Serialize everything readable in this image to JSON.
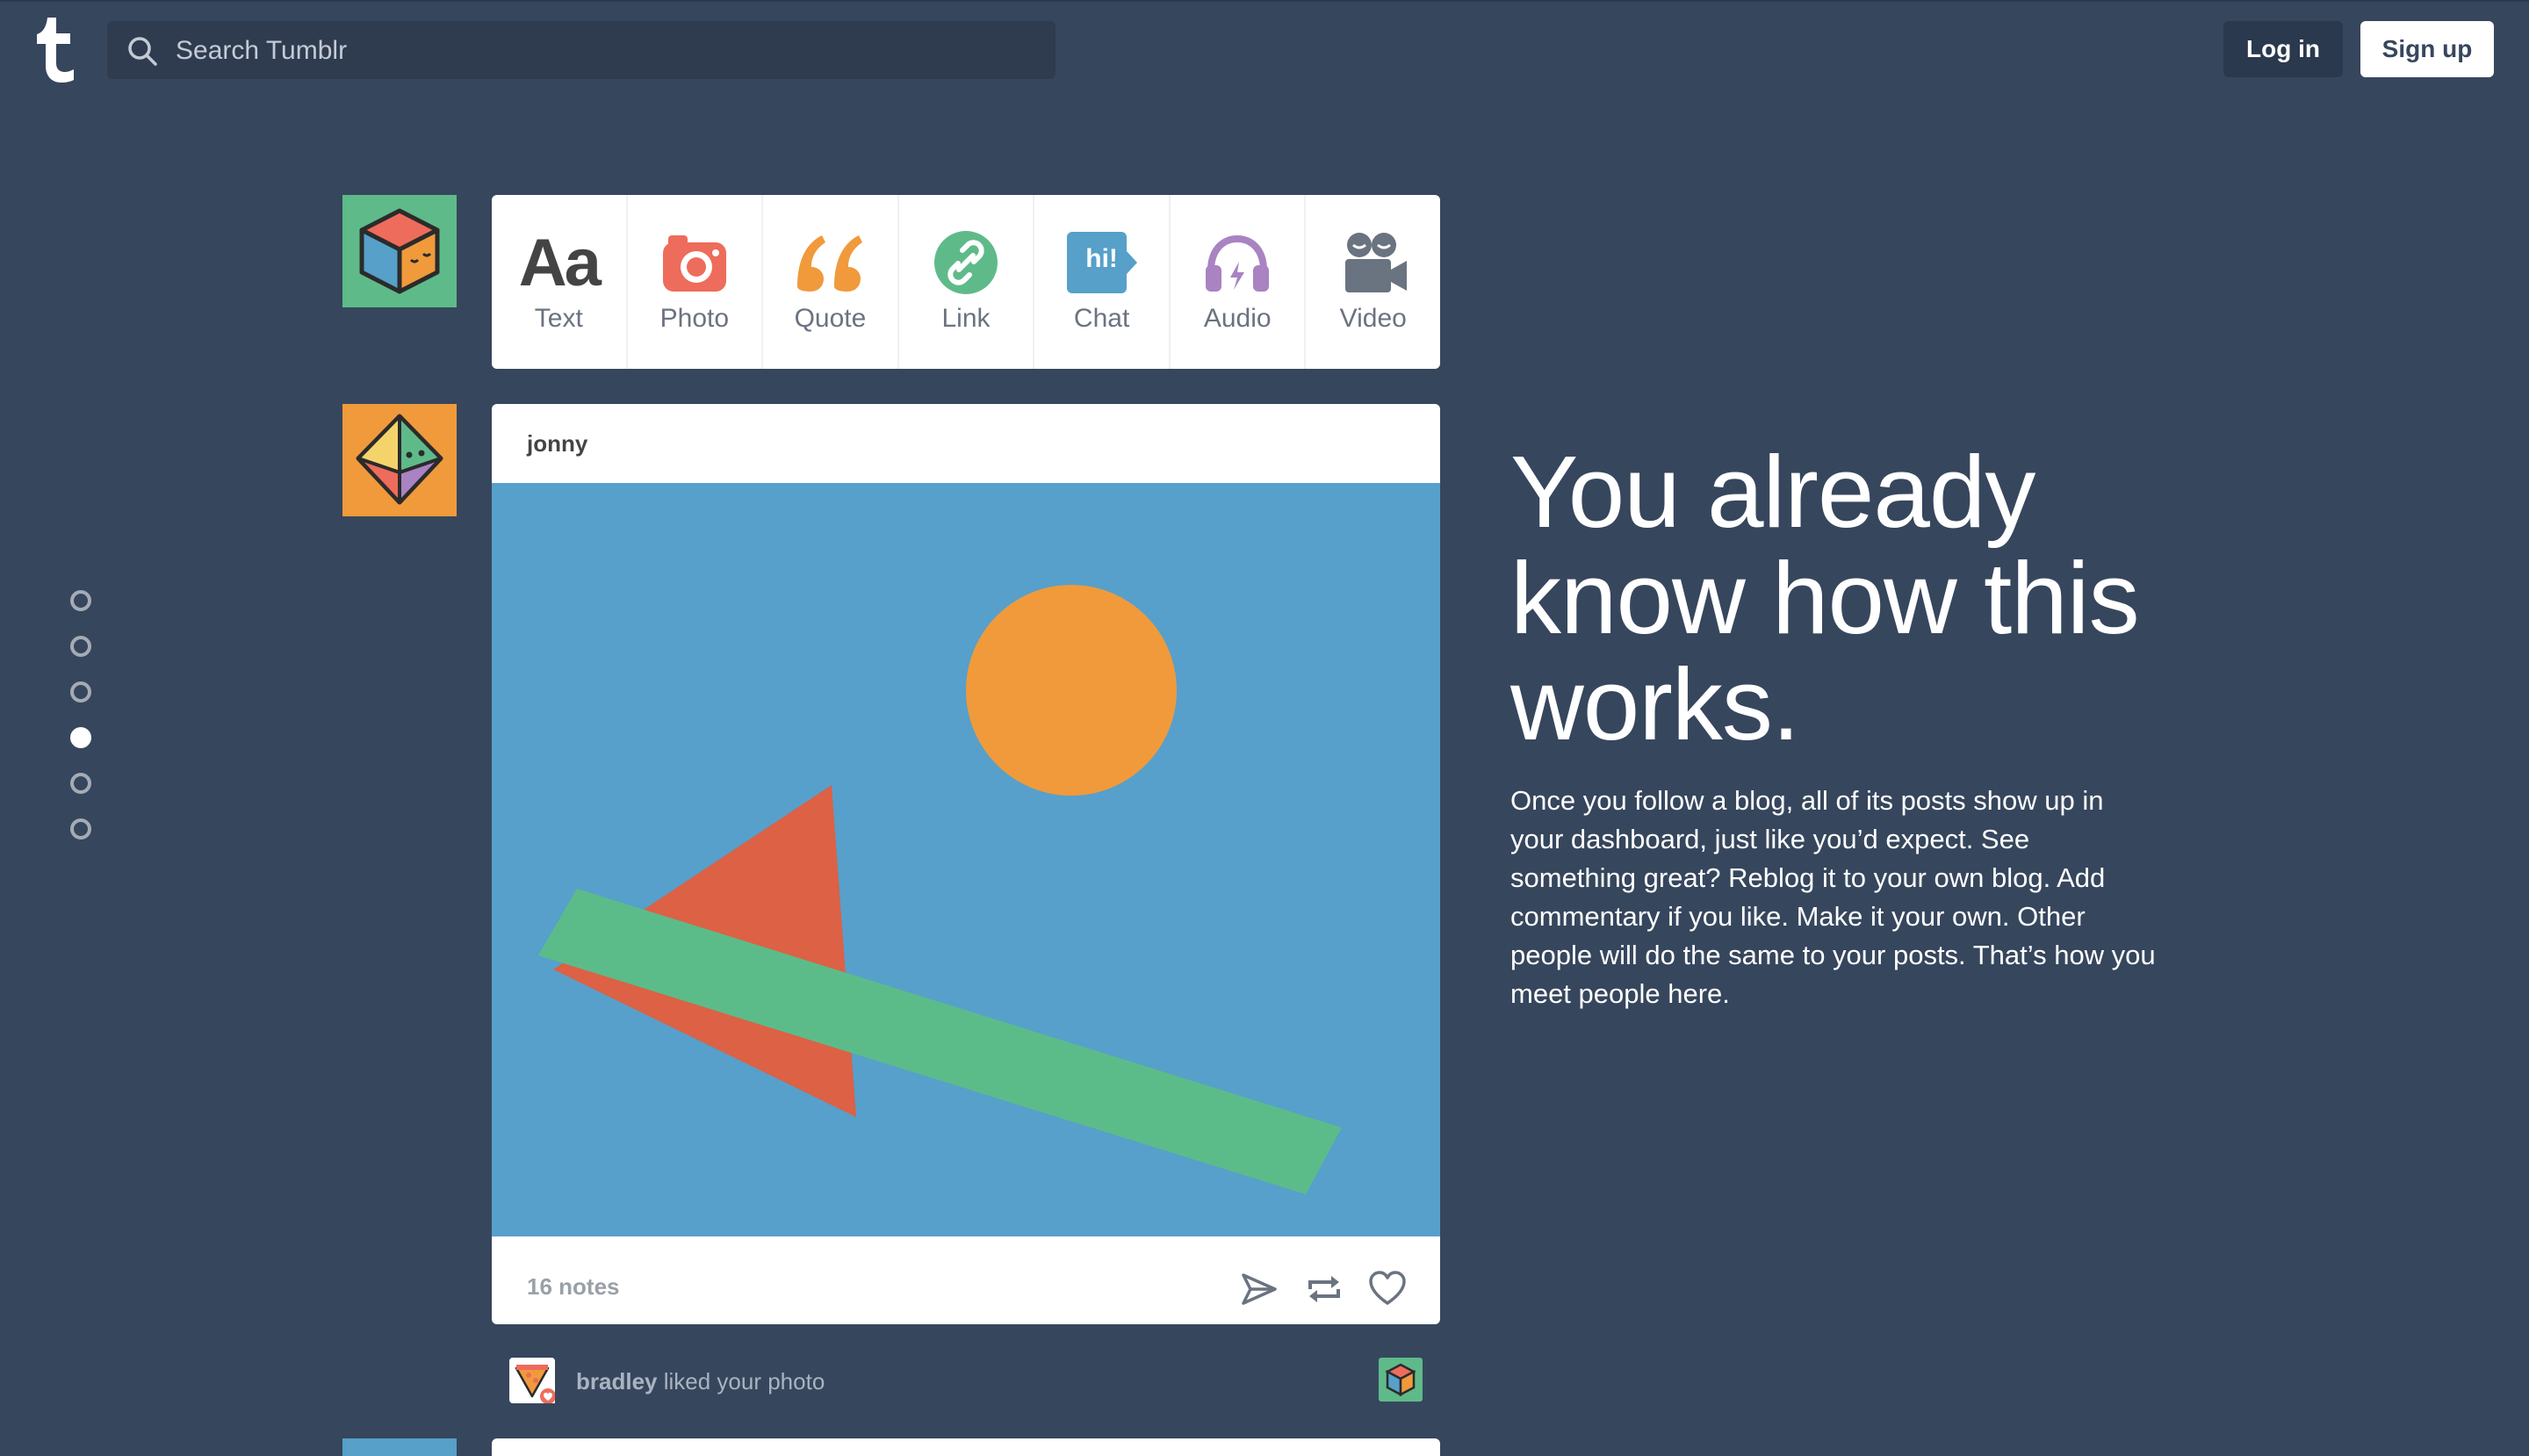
{
  "search": {
    "placeholder": "Search Tumblr"
  },
  "header": {
    "login_label": "Log in",
    "signup_label": "Sign up"
  },
  "composer": {
    "items": [
      {
        "label": "Text",
        "icon": "text-aa-icon",
        "glyph": "Aa"
      },
      {
        "label": "Photo",
        "icon": "camera-icon"
      },
      {
        "label": "Quote",
        "icon": "quote-icon"
      },
      {
        "label": "Link",
        "icon": "link-icon"
      },
      {
        "label": "Chat",
        "icon": "chat-bubble-icon",
        "glyph": "hi!"
      },
      {
        "label": "Audio",
        "icon": "headphones-icon"
      },
      {
        "label": "Video",
        "icon": "video-camera-icon"
      }
    ]
  },
  "post": {
    "author": "jonny",
    "notes": "16 notes"
  },
  "activity": {
    "name": "bradley",
    "text": " liked your photo"
  },
  "pager": {
    "count": 6,
    "active_index": 3
  },
  "hero": {
    "headline": "You already know how this works.",
    "body": "Once you follow a blog, all of its posts show up in your dashboard, just like you’d expect. See something great? Reblog it to your own blog. Add commentary if you like. Make it your own. Other people will do the same to your posts. That’s how you meet people here."
  },
  "colors": {
    "background": "#36465d",
    "text": "#444444",
    "photo": "#ee6c5b",
    "quote": "#f09a3c",
    "link": "#5fba8a",
    "chat": "#56a0c9",
    "audio": "#a983c2",
    "video": "#6a7380"
  }
}
